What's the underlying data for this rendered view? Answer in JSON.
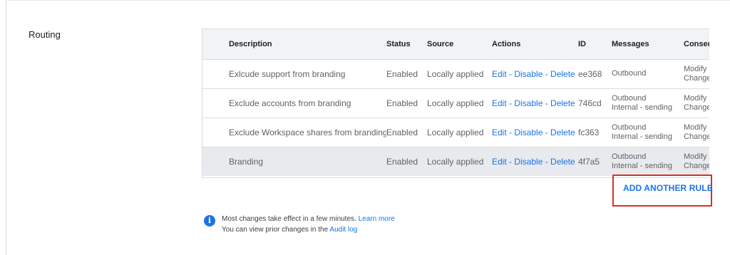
{
  "section": {
    "title": "Routing"
  },
  "table": {
    "headers": [
      "Description",
      "Status",
      "Source",
      "Actions",
      "ID",
      "Messages",
      "Consequences"
    ],
    "rows": [
      {
        "description": "Exlcude support from branding",
        "status": "Enabled",
        "source": "Locally applied",
        "actions": "Edit - Disable - Delete",
        "id": "ee368",
        "messages_1": "Outbound",
        "messages_2": "",
        "consequence_1": "Modify",
        "consequence_2": "Change"
      },
      {
        "description": "Exclude accounts from branding",
        "status": "Enabled",
        "source": "Locally applied",
        "actions": "Edit - Disable - Delete",
        "id": "746cd",
        "messages_1": "Outbound",
        "messages_2": "Internal - sending",
        "consequence_1": "Modify",
        "consequence_2": "Change"
      },
      {
        "description": "Exclude Workspace shares from branding",
        "status": "Enabled",
        "source": "Locally applied",
        "actions": "Edit - Disable - Delete",
        "id": "fc363",
        "messages_1": "Outbound",
        "messages_2": "Internal - sending",
        "consequence_1": "Modify",
        "consequence_2": "Change"
      },
      {
        "description": "Branding",
        "status": "Enabled",
        "source": "Locally applied",
        "actions": "Edit - Disable - Delete",
        "id": "4f7a5",
        "messages_1": "Outbound",
        "messages_2": "Internal - sending",
        "consequence_1": "Modify",
        "consequence_2": "Change"
      }
    ]
  },
  "add_rule": {
    "label": "ADD ANOTHER RULE"
  },
  "info": {
    "line1": "Most changes take effect in a few minutes.",
    "learn_more": "Learn more",
    "line2": "You can view prior changes in the",
    "audit_log": "Audit log",
    "icon": "info-icon"
  },
  "colors": {
    "link": "#1a73e8",
    "highlight": "#d93025",
    "header_bg": "#f1f3f4",
    "selected_row_bg": "#e8eaed"
  }
}
